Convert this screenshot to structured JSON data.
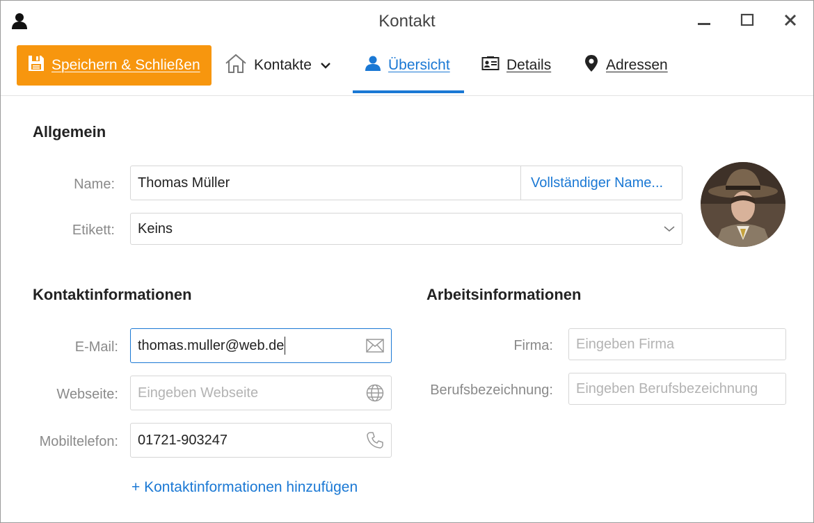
{
  "window": {
    "title": "Kontakt",
    "app_icon": "person-icon"
  },
  "toolbar": {
    "save_label": "Speichern & Schließen",
    "contacts_label": "Kontakte",
    "tabs": [
      {
        "label": "Übersicht",
        "icon": "person-icon",
        "active": true
      },
      {
        "label": "Details",
        "icon": "id-card-icon",
        "active": false
      },
      {
        "label": "Adressen",
        "icon": "map-pin-icon",
        "active": false
      }
    ]
  },
  "general": {
    "title": "Allgemein",
    "name_label": "Name:",
    "name_value": "Thomas Müller",
    "fullname_link": "Vollständiger Name...",
    "tag_label": "Etikett:",
    "tag_value": "Keins"
  },
  "contact_info": {
    "title": "Kontaktinformationen",
    "email_label": "E-Mail:",
    "email_value": "thomas.muller@web.de",
    "website_label": "Webseite:",
    "website_placeholder": "Eingeben Webseite",
    "mobile_label": "Mobiltelefon:",
    "mobile_value": "01721-903247",
    "add_link": "+ Kontaktinformationen hinzufügen"
  },
  "work_info": {
    "title": "Arbeitsinformationen",
    "company_label": "Firma:",
    "company_placeholder": "Eingeben Firma",
    "job_label": "Berufsbezeichnung:",
    "job_placeholder": "Eingeben Berufsbezeichnung"
  },
  "colors": {
    "accent": "#1a78d4",
    "save_button": "#f7960e"
  }
}
